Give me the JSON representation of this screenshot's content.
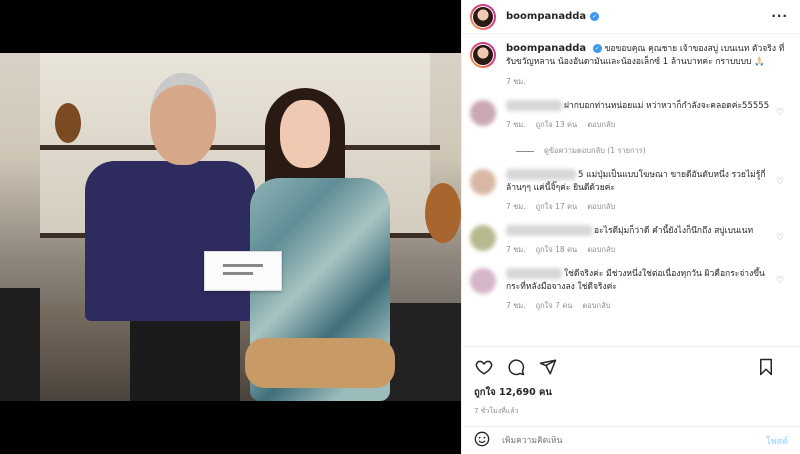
{
  "post": {
    "username": "boompanadda",
    "more_icon": "more-horizontal-icon"
  },
  "caption": {
    "username": "boompanadda",
    "text": "ขอขอบคุณ คุณชาย เจ้าของสบู่ เบนเนท ตัวจริง ที่รับขวัญหลาน น้องอันดามันและน้องอเล็กซ์ 1 ล้านบาทค่ะ กราบบบบ 🙏🏻",
    "time": "7 ชม."
  },
  "comments": [
    {
      "text": "ฝากบอกท่านหน่อยแม่ หว่าหวาก็กำลังจะคลอดค่ะ55555",
      "time": "7 ชม.",
      "likes": "ถูกใจ 13 คน",
      "reply": "ตอบกลับ",
      "avatar_color": "#c9a8b2"
    },
    {
      "text": "5 แม่ปุ่มเป็นแบบโฆษณา ขายดีอันดับหนึ่ง รวยไม่รู้กี่ล้านๆๆ แค่นี้จิ๊ๆค่ะ ยินดีด้วยค่ะ",
      "time": "7 ชม.",
      "likes": "ถูกใจ 17 คน",
      "reply": "ตอบกลับ",
      "avatar_color": "#d8b8a4"
    },
    {
      "text": "อะไรดีมุ่มก็ว่าดี คำนี้ยังไงก็นึกถึง สบู่เบนเนท",
      "time": "7 ชม.",
      "likes": "ถูกใจ 18 คน",
      "reply": "ตอบกลับ",
      "avatar_color": "#b7b98e"
    },
    {
      "text": "ใช่ดีจริงค่ะ มีช่วงหนึ่งใช่ต่อเนื่องทุกวัน ผิวคือกระจ่างขึ้น กระที่หลังมือจางลง ใช่ดีจริงค่ะ",
      "time": "7 ชม.",
      "likes": "ถูกใจ 7 คน",
      "reply": "ตอบกลับ",
      "avatar_color": "#d5b5c9"
    }
  ],
  "view_replies": "ดูข้อความตอบกลับ (1 รายการ)",
  "likes": "ถูกใจ 12,690 คน",
  "post_time": "7 ชั่วโมงที่แล้ว",
  "comment_input": {
    "placeholder": "เพิ่มความคิดเห็น",
    "post_label": "โพสต์"
  },
  "icons": {
    "like": "heart-icon",
    "comment": "comment-icon",
    "share": "share-icon",
    "save": "bookmark-icon",
    "emoji": "emoji-icon"
  },
  "colors": {
    "verified": "#3897f0",
    "post_button": "#b2dffc"
  }
}
